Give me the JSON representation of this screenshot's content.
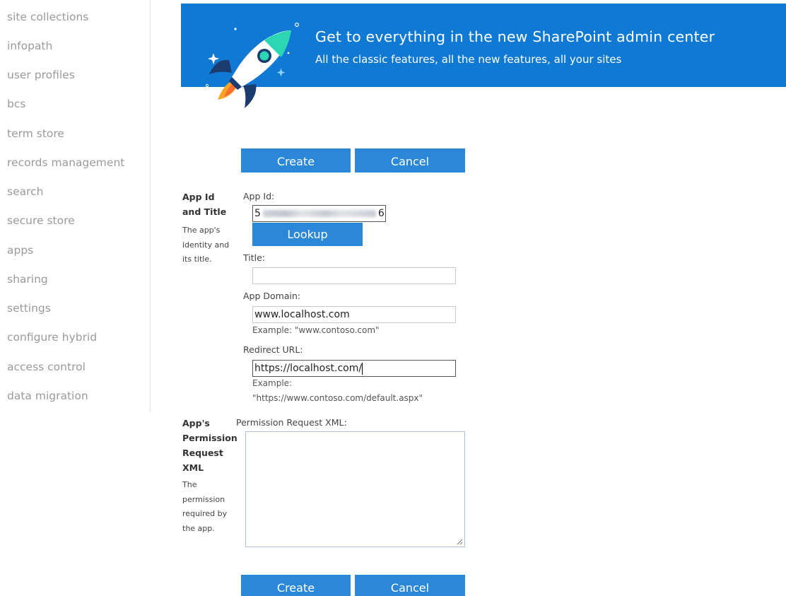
{
  "nav": {
    "items": [
      "site collections",
      "infopath",
      "user profiles",
      "bcs",
      "term store",
      "records management",
      "search",
      "secure store",
      "apps",
      "sharing",
      "settings",
      "configure hybrid",
      "access control",
      "data migration"
    ]
  },
  "banner": {
    "title": "Get to everything in the new SharePoint admin center",
    "subtitle": "All the classic features, all the new features, all your sites",
    "icon": "rocket-icon"
  },
  "buttons": {
    "create": "Create",
    "cancel": "Cancel",
    "lookup": "Lookup"
  },
  "sections": {
    "app_id": {
      "title_line1": "App Id",
      "title_line2": "and Title",
      "desc_line1": "The app's",
      "desc_line2": "identity and",
      "desc_line3": "its title."
    },
    "permission": {
      "title_line1": "App's",
      "title_line2": "Permission",
      "title_line3": "Request",
      "title_line4": "XML",
      "desc_line1": "The",
      "desc_line2": "permission",
      "desc_line3": "required by",
      "desc_line4": "the app."
    }
  },
  "fields": {
    "app_id": {
      "label": "App Id:",
      "value_start": "5",
      "value_end": "6"
    },
    "title": {
      "label": "Title:",
      "value": ""
    },
    "app_domain": {
      "label": "App Domain:",
      "value": "www.localhost.com",
      "example": "Example: \"www.contoso.com\""
    },
    "redirect_url": {
      "label": "Redirect URL:",
      "value": "https://localhost.com/",
      "example_line1": "Example:",
      "example_line2": "\"https://www.contoso.com/default.aspx\""
    },
    "permission_xml": {
      "label": "Permission Request XML:",
      "value": ""
    }
  },
  "colors": {
    "banner": "#0f79d4",
    "button": "#2b88d8",
    "nav_text": "#9a9a9a"
  }
}
